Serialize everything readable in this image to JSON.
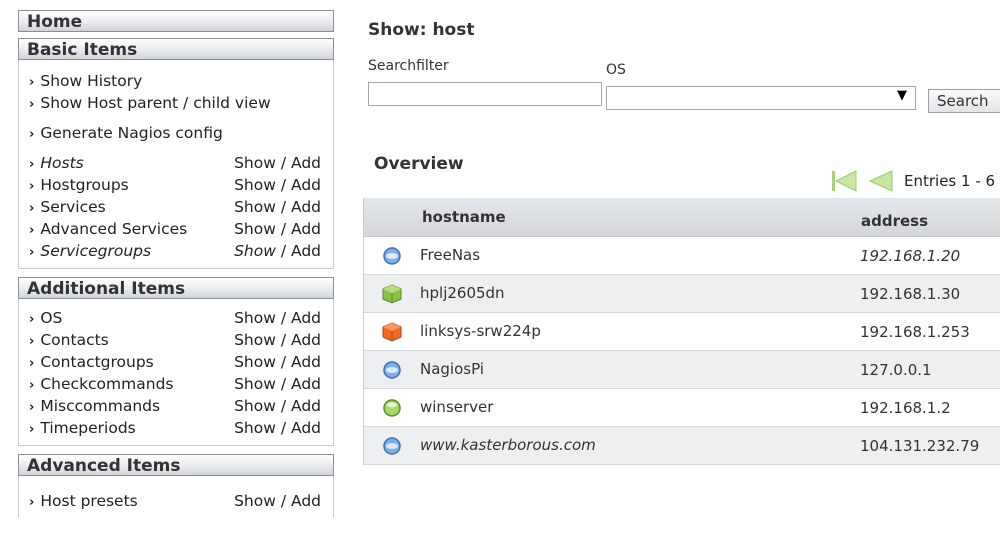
{
  "sidebar": {
    "home": "Home",
    "basic": {
      "title": "Basic Items",
      "links": [
        "Show History",
        "Show Host parent / child view",
        "Generate Nagios config"
      ],
      "items": [
        {
          "label": "Hosts",
          "show": "Show",
          "sep": " / ",
          "add": "Add",
          "italic": true
        },
        {
          "label": "Hostgroups",
          "show": "Show",
          "sep": " / ",
          "add": "Add",
          "italic": false
        },
        {
          "label": "Services",
          "show": "Show",
          "sep": " / ",
          "add": "Add",
          "italic": false
        },
        {
          "label": "Advanced Services",
          "show": "Show",
          "sep": " / ",
          "add": "Add",
          "italic": false
        },
        {
          "label": "Servicegroups",
          "show": "Show",
          "sep": " / ",
          "add": "Add",
          "italic": true
        }
      ]
    },
    "additional": {
      "title": "Additional Items",
      "items": [
        {
          "label": "OS",
          "show": "Show",
          "sep": " / ",
          "add": "Add"
        },
        {
          "label": "Contacts",
          "show": "Show",
          "sep": " / ",
          "add": "Add"
        },
        {
          "label": "Contactgroups",
          "show": "Show",
          "sep": " / ",
          "add": "Add"
        },
        {
          "label": "Checkcommands",
          "show": "Show",
          "sep": " / ",
          "add": "Add"
        },
        {
          "label": "Misccommands",
          "show": "Show",
          "sep": " / ",
          "add": "Add"
        },
        {
          "label": "Timeperiods",
          "show": "Show",
          "sep": " / ",
          "add": "Add"
        }
      ]
    },
    "advanced": {
      "title": "Advanced Items",
      "items": [
        {
          "label": "Host presets",
          "show": "Show",
          "sep": " / ",
          "add": "Add"
        }
      ]
    }
  },
  "main": {
    "title": "Show: host",
    "search_label": "Searchfilter",
    "search_value": "",
    "os_label": "OS",
    "os_value": "",
    "search_button": "Search",
    "overview": "Overview",
    "entries": "Entries 1 - 6",
    "columns": {
      "hostname": "hostname",
      "address": "address"
    },
    "rows": [
      {
        "hostname": "FreeNas",
        "address": "192.168.1.20",
        "icon": "freebsd-icon",
        "italic_addr": true
      },
      {
        "hostname": "hplj2605dn",
        "address": "192.168.1.30",
        "icon": "green-cube-icon",
        "italic_addr": false
      },
      {
        "hostname": "linksys-srw224p",
        "address": "192.168.1.253",
        "icon": "orange-cube-icon",
        "italic_addr": false
      },
      {
        "hostname": "NagiosPi",
        "address": "127.0.0.1",
        "icon": "blue-globe-icon",
        "italic_addr": false
      },
      {
        "hostname": "winserver",
        "address": "192.168.1.2",
        "icon": "green-orb-icon",
        "italic_addr": false
      },
      {
        "hostname": "www.kasterborous.com",
        "address": "104.131.232.79",
        "icon": "blue-globe-icon",
        "italic_host": true,
        "italic_addr": false
      }
    ]
  },
  "colors": {
    "header_bg": "#dfe2e6",
    "accent_green": "#8cc24a",
    "accent_orange": "#ef6a22",
    "accent_blue": "#5a8fd6"
  }
}
